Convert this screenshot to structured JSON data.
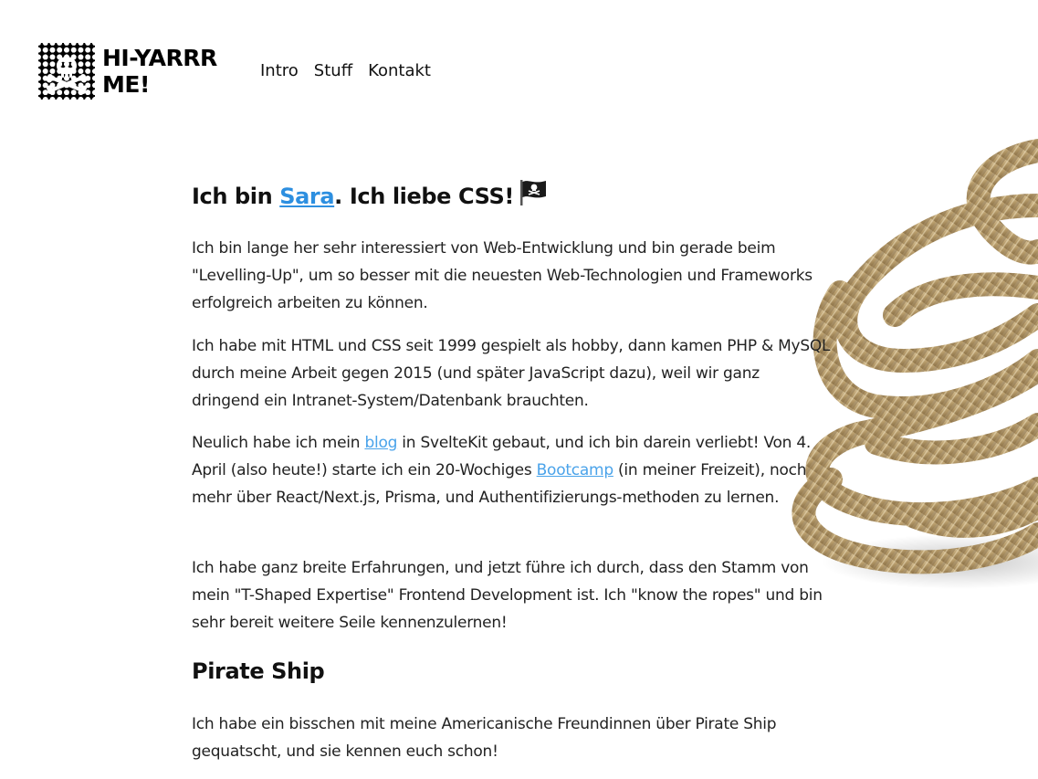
{
  "logo": {
    "line1": "HI-YARRR",
    "line2": "ME!",
    "icon": "skull-crossbones-stamp-icon"
  },
  "nav": {
    "items": [
      {
        "label": "Intro"
      },
      {
        "label": "Stuff"
      },
      {
        "label": "Kontakt"
      }
    ]
  },
  "hero": {
    "heading_before": "Ich bin ",
    "heading_link": "Sara",
    "heading_after": ". Ich liebe CSS!",
    "heading_icon": "pirate-flag-icon",
    "image": "rope-coil-image"
  },
  "paragraphs": {
    "p1": "Ich bin lange her sehr interessiert von Web-Entwicklung und bin gerade beim \"Levelling-Up\", um so besser mit die neuesten Web-Technologien und Frameworks erfolgreich arbeiten zu können.",
    "p2": "Ich habe mit HTML und CSS seit 1999 gespielt als hobby, dann kamen PHP & MySQL durch meine Arbeit gegen 2015 (und später JavaScript dazu), weil wir ganz dringend ein Intranet-System/Datenbank brauchten.",
    "p3": {
      "before": "Neulich habe ich mein ",
      "link1": "blog",
      "middle": " in SvelteKit gebaut, und ich bin darein verliebt! Von 4. April (also heute!) starte ich ein 20-Wochiges ",
      "link2": "Bootcamp",
      "after": " (in meiner Freizeit), noch mehr über React/Next.js, Prisma, und Authentifizierungs-methoden zu lernen."
    },
    "p4": "Ich habe ganz breite Erfahrungen, und jetzt führe ich durch, dass den Stamm von mein \"T-Shaped Expertise\" Frontend Development ist. Ich \"know the ropes\" und bin sehr bereit weitere Seile kennenzulernen!"
  },
  "section2": {
    "heading": "Pirate Ship",
    "p": "Ich habe ein bisschen mit meine Americanische Freundinnen über Pirate Ship gequatscht, und sie kennen euch schon!"
  },
  "colors": {
    "link": "#2d8fe0",
    "text": "#1c1c1c",
    "logo": "#000000",
    "rope": "#b59a6a"
  }
}
